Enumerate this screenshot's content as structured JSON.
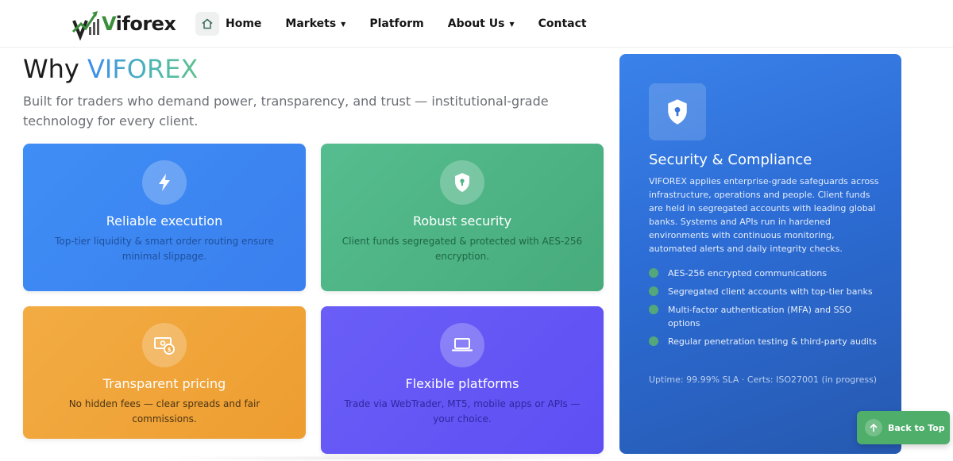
{
  "header": {
    "logo": {
      "text": "Viforex",
      "icon": "viforex-logo-mark"
    },
    "nav": [
      {
        "label": "Home",
        "icon": "home-icon",
        "has_dropdown": false
      },
      {
        "label": "Markets",
        "has_dropdown": true,
        "caret": "▼"
      },
      {
        "label": "Platform",
        "has_dropdown": false
      },
      {
        "label": "About Us",
        "has_dropdown": true,
        "caret": "▼"
      },
      {
        "label": "Contact",
        "has_dropdown": false
      }
    ]
  },
  "hero": {
    "title_prefix": "Why ",
    "title_brand": "VIFOREX",
    "subtitle": "Built for traders who demand power, transparency, and trust — institutional-grade technology for every client."
  },
  "features": [
    {
      "title": "Reliable execution",
      "description": "Top-tier liquidity & smart order routing ensure minimal slippage.",
      "icon": "lightning-icon",
      "color": "#3f8ef5"
    },
    {
      "title": "Robust security",
      "description": "Client funds segregated & protected with AES-256 encryption.",
      "icon": "shield-lock-icon",
      "color": "#55bd8f"
    },
    {
      "title": "Transparent pricing",
      "description": "No hidden fees — clear spreads and fair commissions.",
      "icon": "money-icon",
      "color": "#f2ac43"
    },
    {
      "title": "Flexible platforms",
      "description": "Trade via WebTrader, MT5, mobile apps or APIs — your choice.",
      "icon": "laptop-icon",
      "color": "#6a5ef7"
    }
  ],
  "security_panel": {
    "icon": "shield-lock-icon",
    "title": "Security & Compliance",
    "description": "VIFOREX applies enterprise-grade safeguards across infrastructure, operations and people. Client funds are held in segregated accounts with leading global banks. Systems and APIs run in hardened environments with continuous monitoring, automated alerts and daily integrity checks.",
    "list": [
      "AES-256 encrypted communications",
      "Segregated client accounts with top-tier banks",
      "Multi-factor authentication (MFA) and SSO options",
      "Regular penetration testing & third-party audits"
    ],
    "footer": "Uptime: 99.99% SLA · Certs: ISO27001 (in progress)",
    "color": "#2c6cd4"
  },
  "back_to_top": {
    "label": "Back to Top",
    "icon": "arrow-up-icon",
    "color": "#4fae6a"
  }
}
